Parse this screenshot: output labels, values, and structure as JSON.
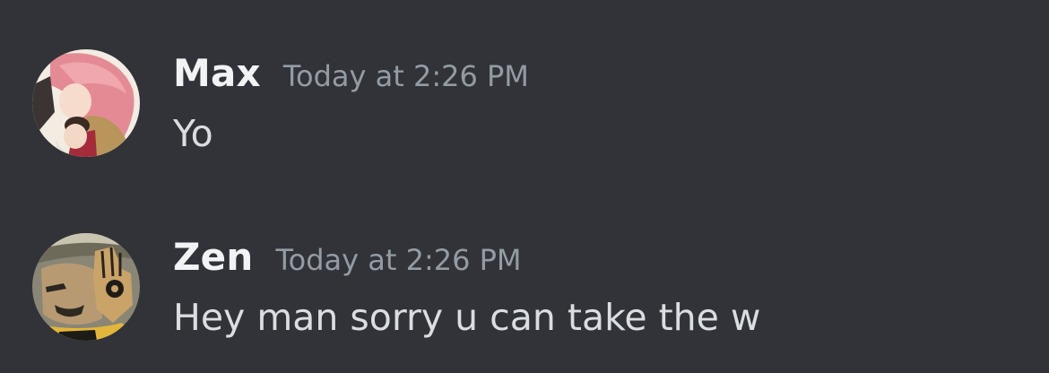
{
  "messages": [
    {
      "username": "Max",
      "timestamp": "Today at 2:26 PM",
      "content": "Yo",
      "avatar": "anime-avatar-pink-hair"
    },
    {
      "username": "Zen",
      "timestamp": "Today at 2:26 PM",
      "content": "Hey man sorry u can take the w",
      "avatar": "anime-avatar-trafalgar-law"
    }
  ],
  "colors": {
    "background": "#313338",
    "username": "#f2f3f5",
    "timestamp": "#949ba4",
    "content": "#dbdee1"
  }
}
